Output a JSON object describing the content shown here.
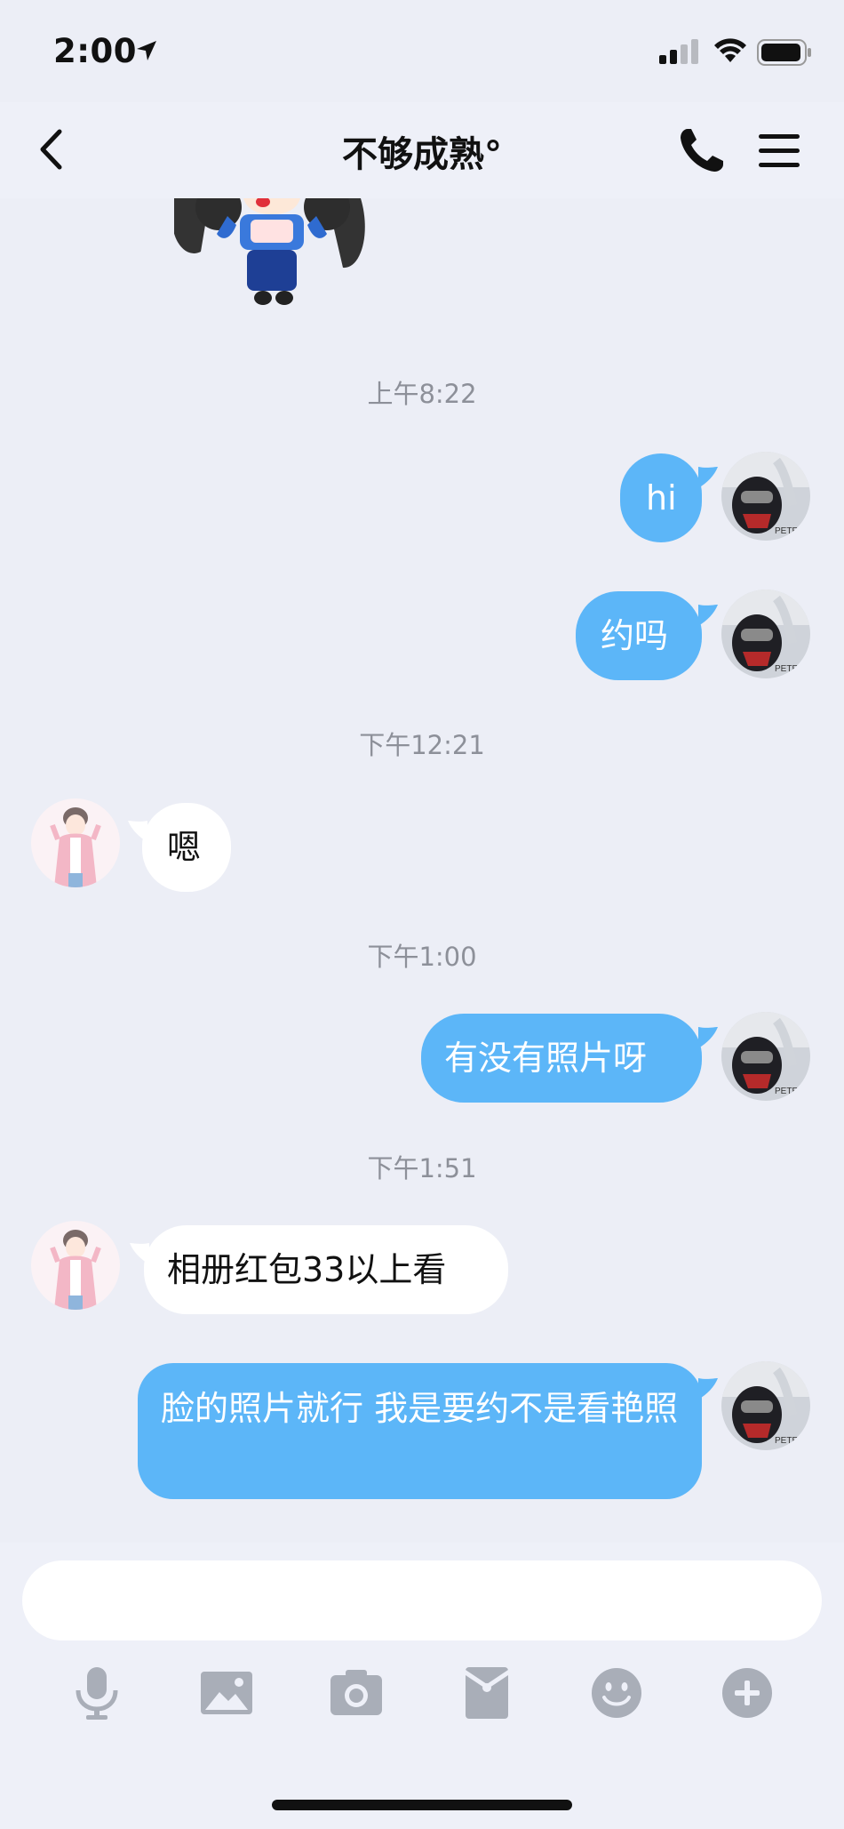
{
  "status_bar": {
    "time": "2:00"
  },
  "nav": {
    "title": "不够成熟°"
  },
  "messages": [
    {
      "kind": "time",
      "text": "上午8:22"
    },
    {
      "kind": "out",
      "text": "hi"
    },
    {
      "kind": "out",
      "text": "约吗"
    },
    {
      "kind": "time",
      "text": "下午12:21"
    },
    {
      "kind": "in",
      "text": "嗯"
    },
    {
      "kind": "time",
      "text": "下午1:00"
    },
    {
      "kind": "out",
      "text": "有没有照片呀"
    },
    {
      "kind": "time",
      "text": "下午1:51"
    },
    {
      "kind": "in",
      "text": "相册红包33以上看"
    },
    {
      "kind": "out",
      "text": "脸的照片就行 我是要约不是看艳照"
    }
  ],
  "input": {
    "placeholder": ""
  },
  "toolbar": [
    "microphone-icon",
    "image-icon",
    "camera-icon",
    "red-packet-icon",
    "emoji-icon",
    "plus-icon"
  ],
  "colors": {
    "outgoing_bubble": "#5cb6f8",
    "incoming_bubble": "#ffffff",
    "background": "#eceef6"
  }
}
